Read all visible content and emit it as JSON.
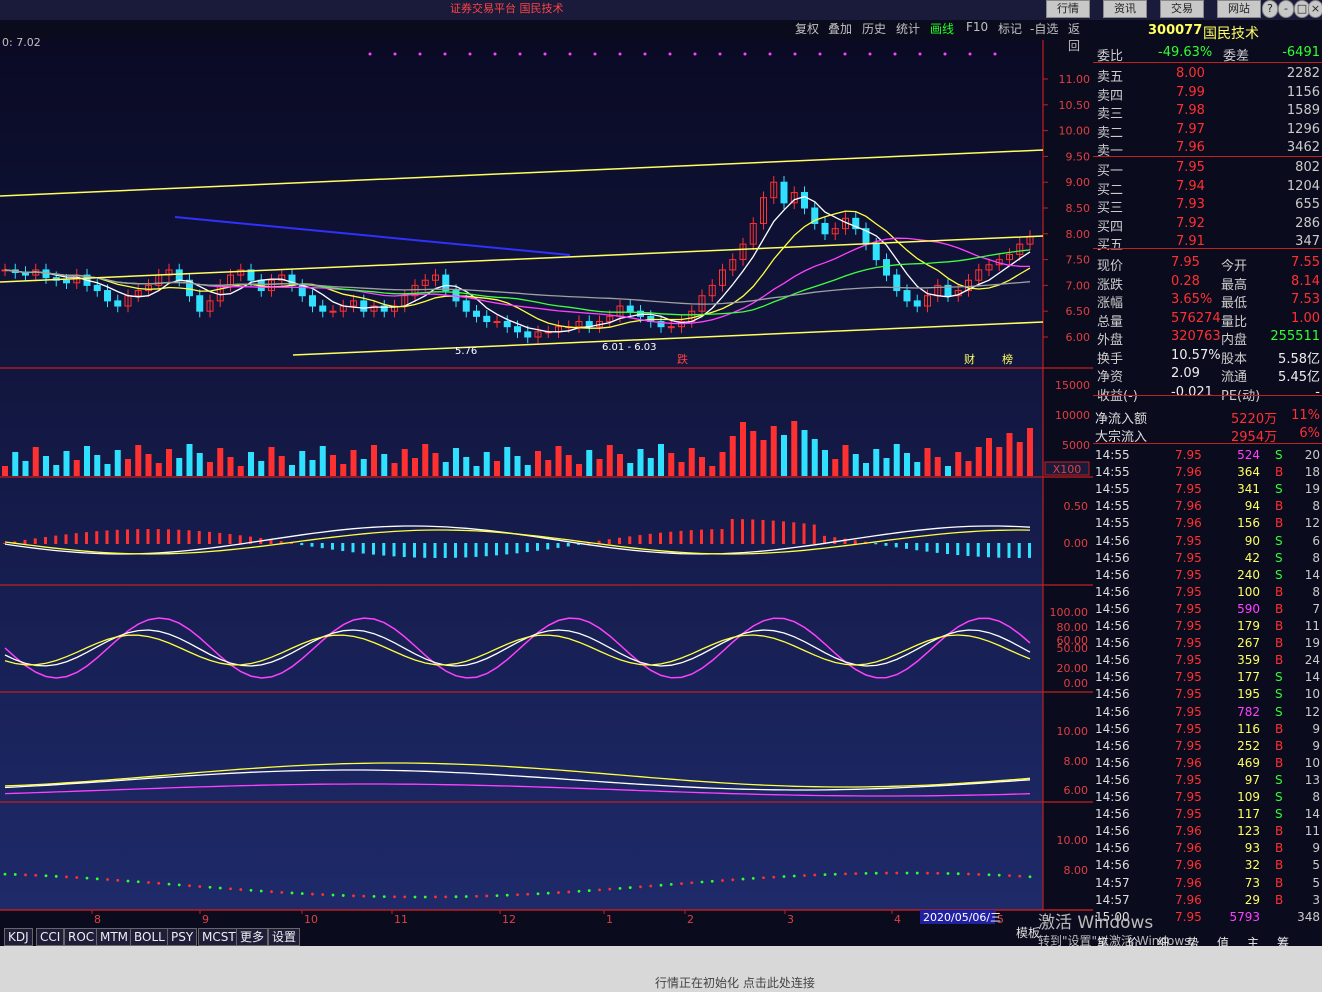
{
  "window": {
    "title": "证券交易平台  国民技术",
    "menu_buttons": [
      "行情",
      "资讯",
      "交易",
      "网站"
    ],
    "window_controls": [
      "?",
      "-",
      "□",
      "×"
    ]
  },
  "toolbar": {
    "items": [
      "复权",
      "叠加",
      "历史",
      "统计",
      "画线",
      "F10",
      "标记",
      "-自选",
      "返回"
    ]
  },
  "price_header": {
    "left_label": "0: 7.02"
  },
  "chart_data": {
    "type": "candlestick",
    "y_axis_price": [
      "11.00",
      "10.50",
      "10.00",
      "9.50",
      "9.00",
      "8.50",
      "8.00",
      "7.50",
      "7.00",
      "6.50",
      "6.00"
    ],
    "y_axis_volume": [
      "15000",
      "10000",
      "5000"
    ],
    "volume_unit": "X100",
    "y_axis_macd": [
      "0.50",
      "0.00"
    ],
    "y_axis_kdj": [
      "100.00",
      "80.00",
      "60.00",
      "50.00",
      "20.00",
      "0.00"
    ],
    "y_axis_ind4": [
      "10.00",
      "8.00",
      "6.00"
    ],
    "y_axis_ind5": [
      "10.00",
      "8.00"
    ],
    "x_labels": [
      "8",
      "9",
      "10",
      "11",
      "12",
      "1",
      "2",
      "3",
      "4",
      "5"
    ],
    "cursor_date": "2020/05/06/三",
    "annotations": [
      "5.76",
      "6.01 - 6.03",
      "跌",
      "财",
      "榜"
    ],
    "low_price": 5.76,
    "closes": [
      7.3,
      7.25,
      7.2,
      7.3,
      7.15,
      7.1,
      7.05,
      7.2,
      7.0,
      6.9,
      6.7,
      6.6,
      6.8,
      6.9,
      7.0,
      7.2,
      7.3,
      7.1,
      6.8,
      6.5,
      6.7,
      7.0,
      7.2,
      7.3,
      7.1,
      6.9,
      7.1,
      7.2,
      7.0,
      6.8,
      6.6,
      6.5,
      6.5,
      6.6,
      6.7,
      6.5,
      6.6,
      6.5,
      6.6,
      6.8,
      7.0,
      7.1,
      7.2,
      6.9,
      6.7,
      6.5,
      6.4,
      6.3,
      6.3,
      6.2,
      6.1,
      6.0,
      6.1,
      6.1,
      6.2,
      6.2,
      6.3,
      6.2,
      6.3,
      6.4,
      6.6,
      6.5,
      6.4,
      6.3,
      6.2,
      6.2,
      6.3,
      6.5,
      6.8,
      7.0,
      7.3,
      7.5,
      7.8,
      8.2,
      8.7,
      9.0,
      8.6,
      8.8,
      8.5,
      8.2,
      8.0,
      8.1,
      8.3,
      8.1,
      7.8,
      7.5,
      7.2,
      6.9,
      6.7,
      6.6,
      6.8,
      7.0,
      6.8,
      6.9,
      7.1,
      7.3,
      7.4,
      7.5,
      7.6,
      7.8,
      7.95
    ]
  },
  "side_panel": {
    "code": "300077",
    "name": "国民技术",
    "weibi": {
      "label": "委比",
      "pct": "-49.63%",
      "label2": "委差",
      "value": "-6491"
    },
    "asks": [
      {
        "label": "卖五",
        "price": "8.00",
        "vol": "2282"
      },
      {
        "label": "卖四",
        "price": "7.99",
        "vol": "1156"
      },
      {
        "label": "卖三",
        "price": "7.98",
        "vol": "1589"
      },
      {
        "label": "卖二",
        "price": "7.97",
        "vol": "1296"
      },
      {
        "label": "卖一",
        "price": "7.96",
        "vol": "3462"
      }
    ],
    "bids": [
      {
        "label": "买一",
        "price": "7.95",
        "vol": "802"
      },
      {
        "label": "买二",
        "price": "7.94",
        "vol": "1204"
      },
      {
        "label": "买三",
        "price": "7.93",
        "vol": "655"
      },
      {
        "label": "买四",
        "price": "7.92",
        "vol": "286"
      },
      {
        "label": "买五",
        "price": "7.91",
        "vol": "347"
      }
    ],
    "stats": [
      {
        "l1": "现价",
        "v1": "7.95",
        "l2": "今开",
        "v2": "7.55"
      },
      {
        "l1": "涨跌",
        "v1": "0.28",
        "l2": "最高",
        "v2": "8.14"
      },
      {
        "l1": "涨幅",
        "v1": "3.65%",
        "l2": "最低",
        "v2": "7.53"
      },
      {
        "l1": "总量",
        "v1": "576274",
        "l2": "量比",
        "v2": "1.00"
      },
      {
        "l1": "外盘",
        "v1": "320763",
        "l2": "内盘",
        "v2": "255511"
      },
      {
        "l1": "换手",
        "v1": "10.57%",
        "l2": "股本",
        "v2": "5.58亿"
      },
      {
        "l1": "净资",
        "v1": "2.09",
        "l2": "流通",
        "v2": "5.45亿"
      },
      {
        "l1": "收益(-)",
        "v1": "-0.021",
        "l2": "PE(动)",
        "v2": "-"
      }
    ],
    "flows": [
      {
        "label": "净流入额",
        "value": "5220万",
        "pct": "11%"
      },
      {
        "label": "大宗流入",
        "value": "2954万",
        "pct": "6%"
      }
    ],
    "ticks": [
      [
        "14:55",
        "7.95",
        "524",
        "S",
        "20"
      ],
      [
        "14:55",
        "7.96",
        "364",
        "B",
        "18"
      ],
      [
        "14:55",
        "7.95",
        "341",
        "S",
        "19"
      ],
      [
        "14:55",
        "7.96",
        "94",
        "B",
        "8"
      ],
      [
        "14:55",
        "7.96",
        "156",
        "B",
        "12"
      ],
      [
        "14:56",
        "7.95",
        "90",
        "S",
        "6"
      ],
      [
        "14:56",
        "7.95",
        "42",
        "S",
        "8"
      ],
      [
        "14:56",
        "7.95",
        "240",
        "S",
        "14"
      ],
      [
        "14:56",
        "7.95",
        "100",
        "B",
        "8"
      ],
      [
        "14:56",
        "7.95",
        "590",
        "B",
        "7"
      ],
      [
        "14:56",
        "7.95",
        "179",
        "B",
        "11"
      ],
      [
        "14:56",
        "7.95",
        "267",
        "B",
        "19"
      ],
      [
        "14:56",
        "7.95",
        "359",
        "B",
        "24"
      ],
      [
        "14:56",
        "7.95",
        "177",
        "S",
        "14"
      ],
      [
        "14:56",
        "7.95",
        "195",
        "S",
        "10"
      ],
      [
        "14:56",
        "7.95",
        "782",
        "S",
        "12"
      ],
      [
        "14:56",
        "7.95",
        "116",
        "B",
        "9"
      ],
      [
        "14:56",
        "7.95",
        "252",
        "B",
        "9"
      ],
      [
        "14:56",
        "7.96",
        "469",
        "B",
        "10"
      ],
      [
        "14:56",
        "7.95",
        "97",
        "S",
        "13"
      ],
      [
        "14:56",
        "7.95",
        "109",
        "S",
        "8"
      ],
      [
        "14:56",
        "7.95",
        "117",
        "S",
        "14"
      ],
      [
        "14:56",
        "7.96",
        "123",
        "B",
        "11"
      ],
      [
        "14:56",
        "7.96",
        "93",
        "B",
        "9"
      ],
      [
        "14:56",
        "7.96",
        "32",
        "B",
        "5"
      ],
      [
        "14:57",
        "7.96",
        "73",
        "B",
        "5"
      ],
      [
        "14:57",
        "7.96",
        "29",
        "B",
        "3"
      ],
      [
        "15:00",
        "7.95",
        "5793",
        "",
        "348"
      ]
    ]
  },
  "bottom_tabs": [
    "KDJ",
    "CCI",
    "ROC",
    "MTM",
    "BOLL",
    "PSY",
    "MCST",
    "更多",
    "设置"
  ],
  "bottom_right": {
    "label1": "模板",
    "label2": "激活 Windows",
    "label3": "转到\"设置\"以激活 Windows。"
  },
  "bottom_right_tabs": [
    "笔",
    "价",
    "细",
    "势",
    "值",
    "主",
    "筹"
  ],
  "status_text": "行情正在初始化  点击此处连接"
}
